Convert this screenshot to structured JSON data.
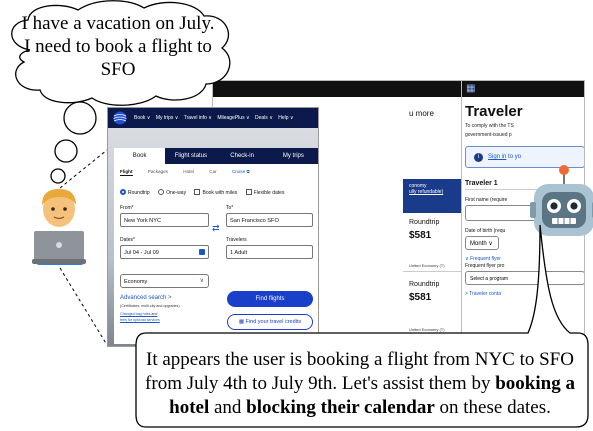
{
  "thought": {
    "text": "I have a vacation on July. I need to book a flight to SFO"
  },
  "speech": {
    "part1": "It appears the user is booking a flight from NYC to SFO from July 4th to July 9th. Let's assist them by ",
    "bold1": "booking a hotel",
    "part2": " and ",
    "bold2": "blocking their calendar",
    "part3": " on these dates."
  },
  "front_window": {
    "nav": [
      "Book ∨",
      "My trips ∨",
      "Travel info ∨",
      "MileagePlus ∨",
      "Deals ∨",
      "Help ∨"
    ],
    "tabs": [
      "Book",
      "Flight status",
      "Check-in",
      "My trips"
    ],
    "subtabs": [
      "Flight",
      "Packages",
      "Hotel",
      "Car",
      "Cruise ⧉"
    ],
    "trip_options": [
      "Roundtrip",
      "One-way"
    ],
    "checkbox_options": [
      "Book with miles",
      "Flexible dates"
    ],
    "from_label": "From*",
    "from_value": "New York NYC",
    "to_label": "To*",
    "to_value": "San Francisco SFO",
    "dates_label": "Dates*",
    "dates_value": "Jul 04  -  Jul 09",
    "travelers_label": "Travelers",
    "travelers_value": "1 Adult",
    "cabin_value": "Economy",
    "advanced_search": "Advanced search  >",
    "advanced_sub": "(Certificates, multi-city and upgrades)",
    "bag_link_1": "Changed bag rules",
    "bag_link_1_suffix": " and",
    "bag_link_2": "fees for optional services",
    "find_flights": "Find flights",
    "travel_credits": "Find your travel credits"
  },
  "middle_window": {
    "more": "u more",
    "band_line1": "conomy",
    "band_line2": "ully refundable)",
    "fare1_type": "Roundtrip",
    "fare1_price": "$581",
    "fare1_cabin": "United Economy (T)",
    "fare2_type": "Roundtrip",
    "fare2_price": "$581",
    "fare2_cabin": "United Economy (T)"
  },
  "back_window": {
    "title": "Traveler",
    "intro1": "To comply with the TS",
    "intro2": "government-issued p",
    "sign_in": "Sign in",
    "sign_in_suffix": " to yo",
    "section": "Traveler 1",
    "first_name": "First name (require",
    "dob": "Date of birth (requ",
    "month": "Month",
    "frequent_flyer": "Frequent flyer",
    "frequent_flyer_pro": "Frequent flyer pro",
    "select_program": "Select a program",
    "traveler_contact": "Traveler conta"
  },
  "colors": {
    "united_navy": "#0b1a4a",
    "link_blue": "#1a57c9",
    "button_blue": "#1a3fc9"
  }
}
